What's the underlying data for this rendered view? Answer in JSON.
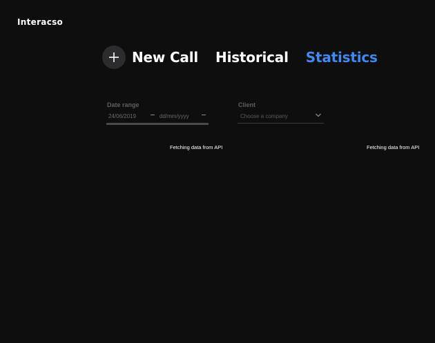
{
  "app": {
    "logo_text": "Interacso"
  },
  "nav": {
    "new_call_label": "New Call",
    "historical_label": "Historical",
    "statistics_label": "Statistics",
    "active_tab": "Statistics",
    "active_color": "#3d8bf2",
    "plus_icon": "plus-icon"
  },
  "filters": {
    "date_range": {
      "label": "Date range",
      "from_value": "24/06/2019",
      "to_placeholder": "dd/mm/yyyy"
    },
    "client": {
      "label": "Client",
      "placeholder": "Choose a company",
      "icon": "chevron-down-icon"
    }
  },
  "status": {
    "left_message": "Fetching data from API",
    "right_message": "Fetching data from API"
  }
}
